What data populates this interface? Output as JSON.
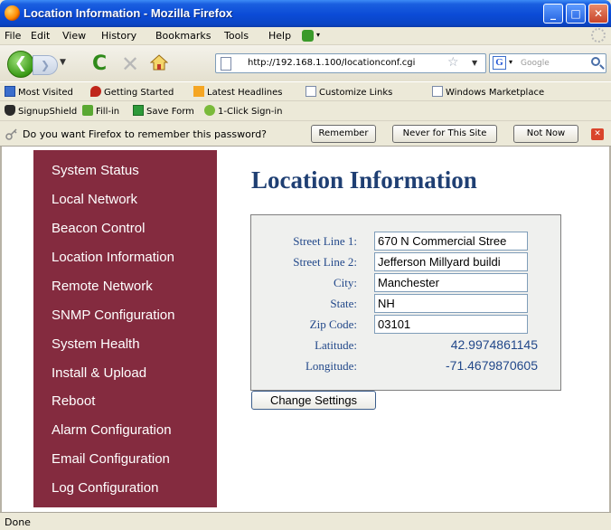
{
  "window": {
    "title": "Location Information - Mozilla Firefox",
    "controls": [
      "_",
      "□",
      "✕"
    ]
  },
  "menu": {
    "items": [
      {
        "label": "File",
        "accel": "F"
      },
      {
        "label": "Edit",
        "accel": "E"
      },
      {
        "label": "View",
        "accel": "V"
      },
      {
        "label": "History",
        "accel": "s"
      },
      {
        "label": "Bookmarks",
        "accel": "B"
      },
      {
        "label": "Tools",
        "accel": "T"
      },
      {
        "label": "Help",
        "accel": "H"
      }
    ]
  },
  "navigation": {
    "url": "http://192.168.1.100/locationconf.cgi",
    "search_placeholder": "Google",
    "search_engine": "G"
  },
  "bookmarks": [
    {
      "label": "Most Visited",
      "icon": "most-visited-icon"
    },
    {
      "label": "Getting Started",
      "icon": "firefox-icon"
    },
    {
      "label": "Latest Headlines",
      "icon": "rss-icon"
    },
    {
      "label": "Customize Links",
      "icon": "page-icon"
    },
    {
      "label": "Windows Marketplace",
      "icon": "page-icon"
    }
  ],
  "signup_toolbar": [
    {
      "label": "SignupShield",
      "icon": "shield-icon"
    },
    {
      "label": "Fill-in",
      "icon": "fill-in-icon"
    },
    {
      "label": "Save Form",
      "icon": "save-icon"
    },
    {
      "label": "1-Click Sign-in",
      "icon": "sign-in-icon"
    }
  ],
  "password_prompt": {
    "message": "Do you want Firefox to remember this password?",
    "remember": "Remember",
    "never": "Never for This Site",
    "not_now": "Not Now"
  },
  "sidebar": {
    "items": [
      "System Status",
      "Local Network",
      "Beacon Control",
      "Location Information",
      "Remote Network",
      "SNMP Configuration",
      "System Health",
      "Install & Upload",
      "Reboot",
      "Alarm Configuration",
      "Email Configuration",
      "Log Configuration"
    ]
  },
  "page": {
    "title": "Location Information",
    "fields": {
      "street1": {
        "label": "Street Line 1:",
        "value": "670 N Commercial Stree"
      },
      "street2": {
        "label": "Street Line 2:",
        "value": "Jefferson Millyard buildi"
      },
      "city": {
        "label": "City:",
        "value": "Manchester"
      },
      "state": {
        "label": "State:",
        "value": "NH"
      },
      "zip": {
        "label": "Zip Code:",
        "value": "03101"
      },
      "latitude": {
        "label": "Latitude:",
        "value": "42.9974861145"
      },
      "longitude": {
        "label": "Longitude:",
        "value": "-71.4679870605"
      }
    },
    "change_button": "Change Settings"
  },
  "status": {
    "text": "Done"
  },
  "colors": {
    "sidebar_bg": "#842b3f",
    "title_color": "#1f3f73",
    "label_color": "#22488a",
    "titlebar_blue": "#0b4bd6"
  }
}
